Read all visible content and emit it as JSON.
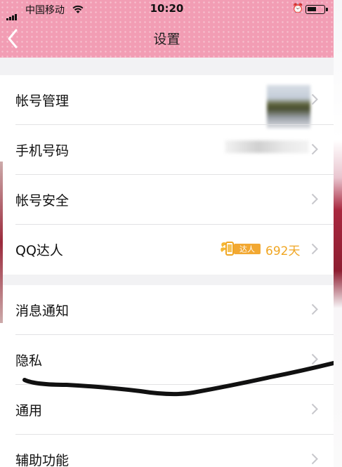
{
  "status_bar": {
    "carrier": "中国移动",
    "time": "10:20",
    "icons": [
      "signal-icon",
      "wifi-icon",
      "alarm-icon",
      "battery-icon"
    ]
  },
  "nav": {
    "title": "设置",
    "back_icon": "chevron-left-icon"
  },
  "groups": [
    {
      "items": [
        {
          "label": "帐号管理"
        },
        {
          "label": "手机号码"
        },
        {
          "label": "帐号安全"
        },
        {
          "label": "QQ达人",
          "badge_text": "达人",
          "days": "692天"
        }
      ]
    },
    {
      "items": [
        {
          "label": "消息通知"
        },
        {
          "label": "隐私"
        },
        {
          "label": "通用"
        },
        {
          "label": "辅助功能"
        }
      ]
    }
  ],
  "colors": {
    "header_pink": "#f29db4",
    "accent_orange": "#f0a623",
    "chevron": "#c7c7cc",
    "background": "#f2f2f4"
  }
}
